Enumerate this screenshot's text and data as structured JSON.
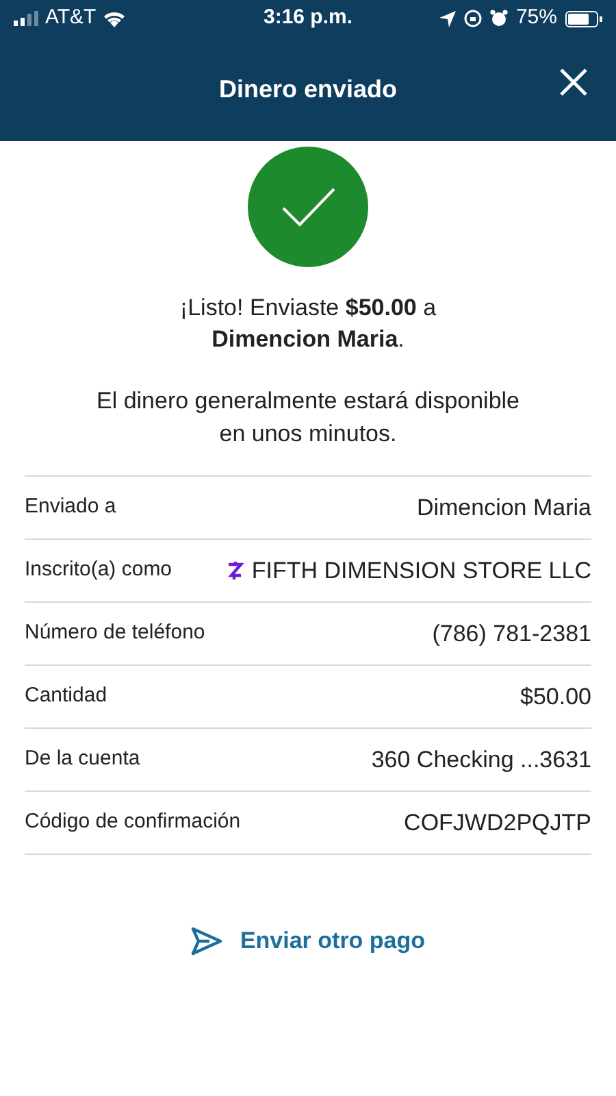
{
  "status_bar": {
    "carrier": "AT&T",
    "time": "3:16 p.m.",
    "battery": "75%"
  },
  "header": {
    "title": "Dinero enviado"
  },
  "message": "¡Listo! Enviaste **$50.00** a **Dimencion Maria**.",
  "note": "El dinero generalmente estará disponible en unos minutos.",
  "details": [
    {
      "label": "Enviado a",
      "value": "Dimencion Maria",
      "kind": "plain"
    },
    {
      "label": "Inscrito(a) como",
      "value": "FIFTH DIMENSION STORE LLC",
      "kind": "zelle"
    },
    {
      "label": "Número de teléfono",
      "value": "(786) 781-2381",
      "kind": "plain"
    },
    {
      "label": "Cantidad",
      "value": "$50.00",
      "kind": "plain"
    },
    {
      "label": "De la cuenta",
      "value": "360 Checking ...3631",
      "kind": "plain"
    },
    {
      "label": "Código de confirmación",
      "value": "COFJWD2PQJTP",
      "kind": "plain"
    }
  ],
  "action": {
    "label": "Enviar otro pago"
  }
}
